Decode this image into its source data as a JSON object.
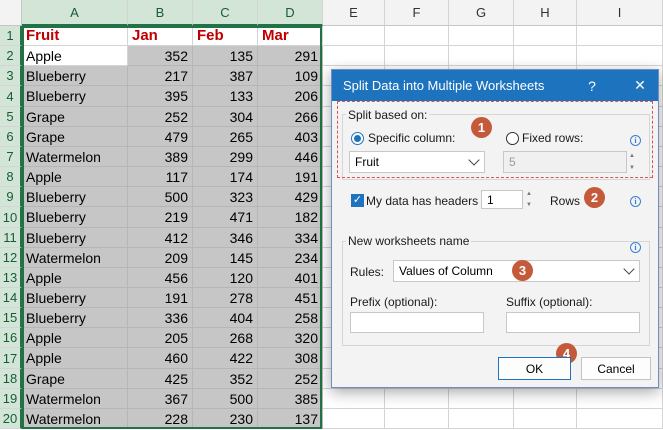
{
  "spreadsheet": {
    "columns": [
      "A",
      "B",
      "C",
      "D",
      "E",
      "F",
      "G",
      "H",
      "I"
    ],
    "header_row": {
      "row": "1",
      "fruit": "Fruit",
      "jan": "Jan",
      "feb": "Feb",
      "mar": "Mar"
    },
    "rows": [
      {
        "row": "2",
        "fruit": "Apple",
        "jan": "352",
        "feb": "135",
        "mar": "291"
      },
      {
        "row": "3",
        "fruit": "Blueberry",
        "jan": "217",
        "feb": "387",
        "mar": "109"
      },
      {
        "row": "4",
        "fruit": "Blueberry",
        "jan": "395",
        "feb": "133",
        "mar": "206"
      },
      {
        "row": "5",
        "fruit": "Grape",
        "jan": "252",
        "feb": "304",
        "mar": "266"
      },
      {
        "row": "6",
        "fruit": "Grape",
        "jan": "479",
        "feb": "265",
        "mar": "403"
      },
      {
        "row": "7",
        "fruit": "Watermelon",
        "jan": "389",
        "feb": "299",
        "mar": "446"
      },
      {
        "row": "8",
        "fruit": "Apple",
        "jan": "117",
        "feb": "174",
        "mar": "191"
      },
      {
        "row": "9",
        "fruit": "Blueberry",
        "jan": "500",
        "feb": "323",
        "mar": "429"
      },
      {
        "row": "10",
        "fruit": "Blueberry",
        "jan": "219",
        "feb": "471",
        "mar": "182"
      },
      {
        "row": "11",
        "fruit": "Blueberry",
        "jan": "412",
        "feb": "346",
        "mar": "334"
      },
      {
        "row": "12",
        "fruit": "Watermelon",
        "jan": "209",
        "feb": "145",
        "mar": "234"
      },
      {
        "row": "13",
        "fruit": "Apple",
        "jan": "456",
        "feb": "120",
        "mar": "401"
      },
      {
        "row": "14",
        "fruit": "Blueberry",
        "jan": "191",
        "feb": "278",
        "mar": "451"
      },
      {
        "row": "15",
        "fruit": "Blueberry",
        "jan": "336",
        "feb": "404",
        "mar": "258"
      },
      {
        "row": "16",
        "fruit": "Apple",
        "jan": "205",
        "feb": "268",
        "mar": "320"
      },
      {
        "row": "17",
        "fruit": "Apple",
        "jan": "460",
        "feb": "422",
        "mar": "308"
      },
      {
        "row": "18",
        "fruit": "Grape",
        "jan": "425",
        "feb": "352",
        "mar": "252"
      },
      {
        "row": "19",
        "fruit": "Watermelon",
        "jan": "367",
        "feb": "500",
        "mar": "385"
      },
      {
        "row": "20",
        "fruit": "Watermelon",
        "jan": "228",
        "feb": "230",
        "mar": "137"
      }
    ]
  },
  "dialog": {
    "title": "Split Data into Multiple Worksheets",
    "help": "?",
    "close": "✕",
    "split_section": {
      "legend": "Split based on:",
      "specific_column_label": "Specific column:",
      "specific_column_selected": true,
      "column_value": "Fruit",
      "fixed_rows_label": "Fixed rows:",
      "fixed_rows_value": "5"
    },
    "headers": {
      "label": "My data has headers",
      "checked": true,
      "count": "1",
      "rows_label": "Rows"
    },
    "names_section": {
      "legend": "New worksheets name",
      "rules_label": "Rules:",
      "rules_value": "Values of Column",
      "prefix_label": "Prefix (optional):",
      "suffix_label": "Suffix (optional):",
      "prefix_value": "",
      "suffix_value": ""
    },
    "ok": "OK",
    "cancel": "Cancel",
    "steps": [
      "1",
      "2",
      "3",
      "4"
    ],
    "info_glyph": "i"
  },
  "colors": {
    "accent": "#1e73be",
    "badge": "#c55a3b",
    "header_text": "#c00000",
    "selection": "#217346"
  }
}
